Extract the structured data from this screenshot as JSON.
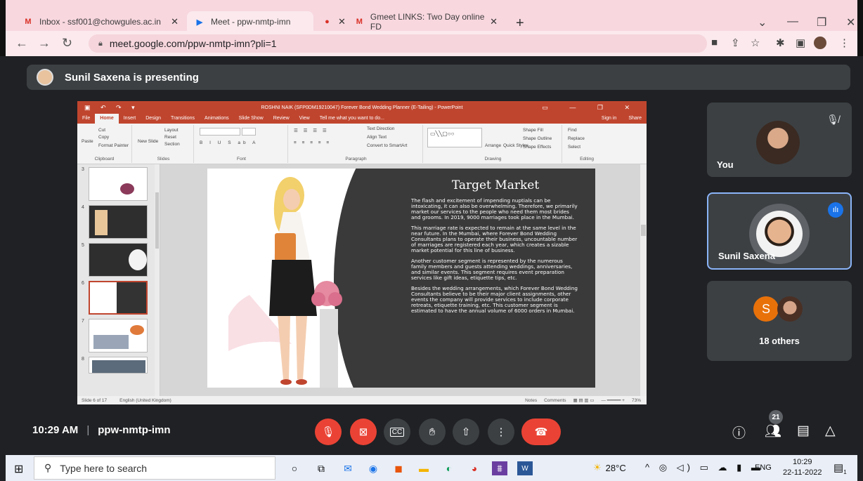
{
  "browser": {
    "tabs": [
      {
        "label": "Inbox - ssf001@chowgules.ac.in",
        "favicon": "M"
      },
      {
        "label": "Meet - ppw-nmtp-imn",
        "favicon": "▶"
      },
      {
        "label": "Gmeet LINKS: Two Day online FD",
        "favicon": "M"
      }
    ],
    "new_tab": "+",
    "url": "meet.google.com/ppw-nmtp-imn?pli=1"
  },
  "meet": {
    "presenting_banner": "Sunil Saxena is presenting",
    "participants": [
      {
        "name": "You"
      },
      {
        "name": "Sunil Saxena"
      }
    ],
    "others": {
      "initial": "S",
      "label": "18 others"
    },
    "time": "10:29 AM",
    "separator": "|",
    "meeting_code": "ppw-nmtp-imn",
    "people_count": "21"
  },
  "powerpoint": {
    "title": "ROSHNI NAIK (SFP0DM19210047) Forever Bond Wedding Planner (E-Tailing) - PowerPoint",
    "tabs": [
      "File",
      "Home",
      "Insert",
      "Design",
      "Transitions",
      "Animations",
      "Slide Show",
      "Review",
      "View",
      "Tell me what you want to do..."
    ],
    "sign_in": "Sign in",
    "share": "Share",
    "ribbon": {
      "cut": "Cut",
      "copy": "Copy",
      "paste": "Paste",
      "format_painter": "Format Painter",
      "clipboard": "Clipboard",
      "new_slide": "New Slide",
      "layout": "Layout",
      "reset": "Reset",
      "section": "Section",
      "slides": "Slides",
      "font": "Font",
      "paragraph": "Paragraph",
      "text_direction": "Text Direction",
      "align_text": "Align Text",
      "convert_smartart": "Convert to SmartArt",
      "arrange": "Arrange",
      "quick_styles": "Quick Styles",
      "shape_fill": "Shape Fill",
      "shape_outline": "Shape Outline",
      "shape_effects": "Shape Effects",
      "drawing": "Drawing",
      "find": "Find",
      "replace": "Replace",
      "select": "Select",
      "editing": "Editing"
    },
    "thumb_numbers": [
      "3",
      "4",
      "5",
      "6",
      "7",
      "8"
    ],
    "slide": {
      "heading": "Target Market",
      "paragraphs": [
        "The flash and excitement of impending nuptials can be intoxicating, it can also be overwhelming. Therefore, we primarily market our services to the people who need them most brides and grooms. In 2019, 9000 marriages took place in the Mumbai.",
        "This marriage rate is expected to remain at the same level in the near future. In the Mumbai, where Forever Bond Wedding Consultants plans to operate their business, uncountable number of marriages are registered each year, which creates a sizable market potential for this line of business.",
        "Another customer segment is represented by the numerous family members and guests attending weddings, anniversaries, and similar events. This segment requires event preparation services like gift ideas, etiquette tips, etc.",
        "Besides the wedding arrangements, which Forever Bond Wedding Consultants believe to be their major client assignments, other events the company will provide services to include corporate retreats, etiquette training, etc. This customer segment is estimated to have the annual volume of 6000 orders in Mumbai."
      ]
    },
    "status": {
      "slide_of": "Slide 6 of 17",
      "language": "English (United Kingdom)",
      "notes": "Notes",
      "comments": "Comments",
      "zoom": "73%"
    }
  },
  "taskbar": {
    "search_placeholder": "Type here to search",
    "temperature": "28°C",
    "language": "ENG",
    "time": "10:29",
    "date": "22-11-2022",
    "notification_count": "1"
  },
  "colors": {
    "meet_bg": "#202124",
    "tile_bg": "#3c4043",
    "red_button": "#ea4335",
    "active_speaker_border": "#8ab4f8",
    "ppt_accent": "#c0452e",
    "tab_strip": "#f8d7df"
  }
}
